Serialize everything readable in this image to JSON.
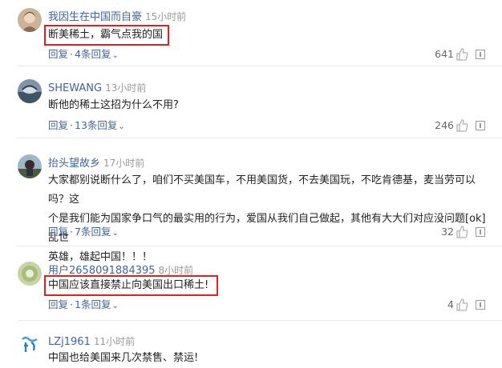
{
  "comments": [
    {
      "username": "我因生在中国而自豪",
      "time": "15小时前",
      "text": "断美稀土，霸气点我的国",
      "reply_label": "回复",
      "replies_label": "4条回复",
      "likes": "641"
    },
    {
      "username": "SHEWANG",
      "time": "13小时前",
      "text": "断他的稀土这招为什么不用?",
      "reply_label": "回复",
      "replies_label": "13条回复",
      "likes": "246"
    },
    {
      "username": "抬头望故乡",
      "time": "17小时前",
      "text_lines": [
        "大家都别说断什么了，咱们不买美国车，不用美国货，不去美国玩，不吃肯德基，麦当劳可以吗？这",
        "个是我们能为国家争口气的最实用的行为，爱国从我们自己做起，其他有大大们对应没问题[ok]乱世",
        "英雄，雄起中国！！！"
      ],
      "reply_label": "回复",
      "replies_label": "7条回复",
      "likes": "32"
    },
    {
      "username": "用户2658091884395",
      "time": "8小时前",
      "text": "中国应该直接禁止向美国出口稀土!",
      "reply_label": "回复",
      "replies_label": "1条回复",
      "likes": "4"
    },
    {
      "username": "LZj1961",
      "time": "11小时前",
      "text": "中国也给美国来几次禁售、禁运!"
    }
  ],
  "colors": {
    "link": "#406599",
    "highlight_border": "#e02020",
    "divider": "#e9e9e9"
  },
  "icons": [
    "thumbs-up-icon",
    "report-icon",
    "chevron-down-icon"
  ]
}
